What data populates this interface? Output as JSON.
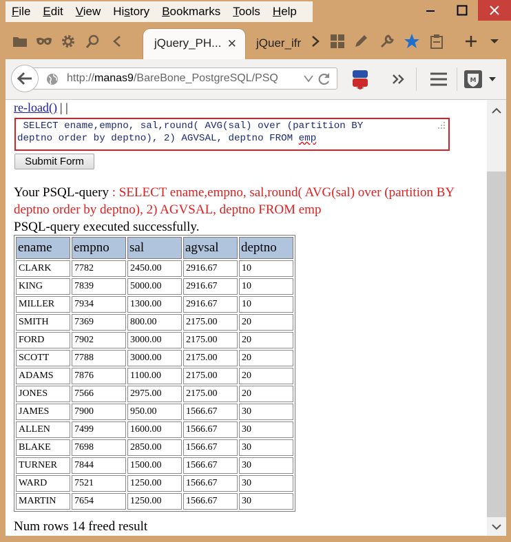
{
  "menu": {
    "file": {
      "acc": "F",
      "rest": "ile"
    },
    "edit": {
      "acc": "E",
      "rest": "dit"
    },
    "view": {
      "acc": "V",
      "rest": "iew"
    },
    "history": {
      "pre": "Hi",
      "acc": "s",
      "rest": "tory"
    },
    "bookmarks": {
      "acc": "B",
      "rest": "ookmarks"
    },
    "tools": {
      "acc": "T",
      "rest": "ools"
    },
    "help": {
      "acc": "H",
      "rest": "elp"
    }
  },
  "tabs": {
    "active": {
      "title": "jQuery_PH...",
      "close": "✕"
    },
    "inactive": {
      "title": "jQuer_ifr"
    }
  },
  "navbar": {
    "url_prefix": "http://",
    "url_host": "manas9",
    "url_path": "/BareBone_PostgreSQL/PSQ"
  },
  "page": {
    "reload_link": "re-load()",
    "reload_sep": "| |",
    "sql_text_main": " SELECT ename,empno, sal,round( AVG(sal) over (partition BY\ndeptno order by deptno), 2) AGVSAL, deptno FROM ",
    "sql_text_squig": "emp",
    "submit_label": "Submit Form",
    "query_label": "Your PSQL-query",
    "query_text": " : SELECT ename,empno, sal,round( AVG(sal) over (partition BY deptno order by deptno), 2) AGVSAL, deptno FROM emp",
    "success_text": "PSQL-query executed successfully.",
    "footer_text": "Num rows 14 freed result"
  },
  "table": {
    "headers": [
      "ename",
      "empno",
      "sal",
      "agvsal",
      "deptno"
    ],
    "rows": [
      [
        "CLARK",
        "7782",
        "2450.00",
        "2916.67",
        "10"
      ],
      [
        "KING",
        "7839",
        "5000.00",
        "2916.67",
        "10"
      ],
      [
        "MILLER",
        "7934",
        "1300.00",
        "2916.67",
        "10"
      ],
      [
        "SMITH",
        "7369",
        "800.00",
        "2175.00",
        "20"
      ],
      [
        "FORD",
        "7902",
        "3000.00",
        "2175.00",
        "20"
      ],
      [
        "SCOTT",
        "7788",
        "3000.00",
        "2175.00",
        "20"
      ],
      [
        "ADAMS",
        "7876",
        "1100.00",
        "2175.00",
        "20"
      ],
      [
        "JONES",
        "7566",
        "2975.00",
        "2175.00",
        "20"
      ],
      [
        "JAMES",
        "7900",
        "950.00",
        "1566.67",
        "30"
      ],
      [
        "ALLEN",
        "7499",
        "1600.00",
        "1566.67",
        "30"
      ],
      [
        "BLAKE",
        "7698",
        "2850.00",
        "1566.67",
        "30"
      ],
      [
        "TURNER",
        "7844",
        "1500.00",
        "1566.67",
        "30"
      ],
      [
        "WARD",
        "7521",
        "1250.00",
        "1566.67",
        "30"
      ],
      [
        "MARTIN",
        "7654",
        "1250.00",
        "1566.67",
        "30"
      ]
    ]
  },
  "colors": {
    "frame": "#d3a46f",
    "close_button": "#c7403a",
    "link": "#1a1aa6",
    "query_red": "#e02020",
    "table_header": "#b0c4de",
    "sql_border": "#d61f26"
  },
  "icons": {
    "toolbar": [
      "folder-icon",
      "mask-icon",
      "gear-icon",
      "search-icon",
      "chevron-left-icon",
      "chevron-right-icon",
      "grid-icon",
      "wrench-icon",
      "star-icon",
      "clipboard-icon",
      "plus-icon",
      "chevron-down-icon"
    ],
    "navbar": [
      "back-arrow-icon",
      "globe-icon",
      "dropdown-icon",
      "reload-icon",
      "youtube-download-icon",
      "overflow-icon",
      "hamburger-menu-icon",
      "shield-extension-icon"
    ]
  }
}
